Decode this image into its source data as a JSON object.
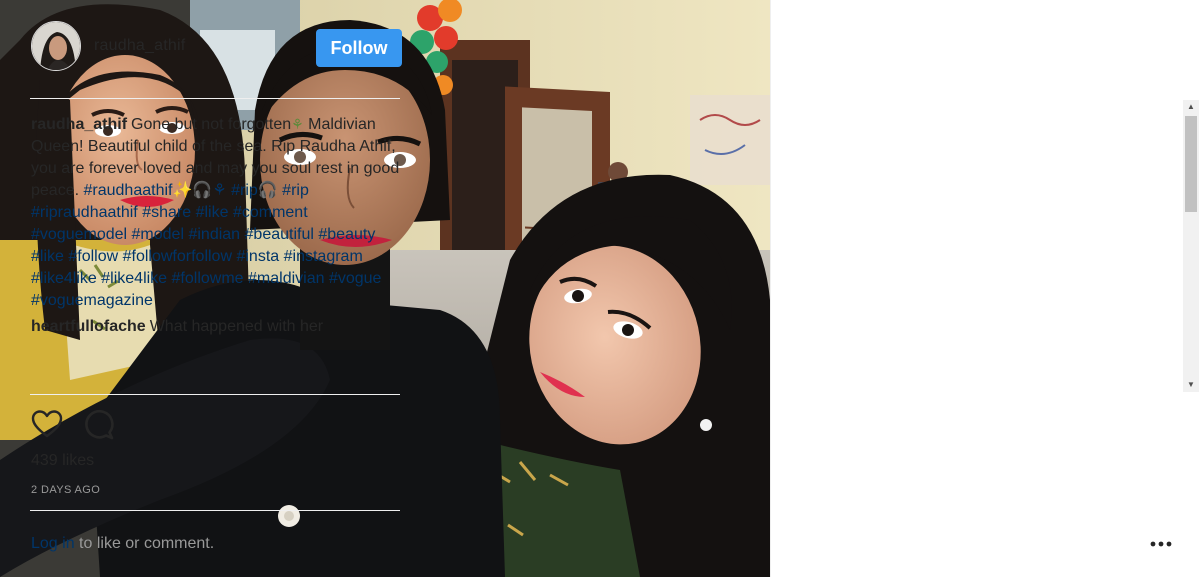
{
  "post": {
    "username": "raudha_athif",
    "follow_label": "Follow",
    "likes": "439 likes",
    "timestamp": "2 DAYS AGO"
  },
  "comments": [
    {
      "user": "raudha_athif",
      "text": "Gone but not forgotten",
      "text2": " Maldivian Queen! Beautiful child of the sea. Rip Raudha Athif, you are forever loved and may you soul rest in good peace.",
      "flower": "⚘",
      "hashtags": [
        "#raudhaathif✨🎧⚘",
        "#rip🎧",
        "#rip",
        "#ripraudhaathif",
        "#share",
        "#like",
        "#comment",
        "#voguemodel",
        "#model",
        "#indian",
        "#beautiful",
        "#beauty",
        "#like",
        "#follow",
        "#followforfollow",
        "#insta",
        "#instagram",
        "#like4like",
        "#like4like",
        "#followme",
        "#maldivian",
        "#vogue",
        "#voguemagazine"
      ]
    },
    {
      "user": "heartfullofache",
      "text": "What happened with her"
    }
  ],
  "footer": {
    "login_link": "Log in",
    "login_rest": " to like or comment.",
    "more_icon": "ellipsis-icon"
  },
  "icons": {
    "like": "heart-icon",
    "comment": "comment-bubble-icon"
  },
  "colors": {
    "follow_button": "#3897f0",
    "hashtag": "#003569",
    "muted": "#999999"
  }
}
